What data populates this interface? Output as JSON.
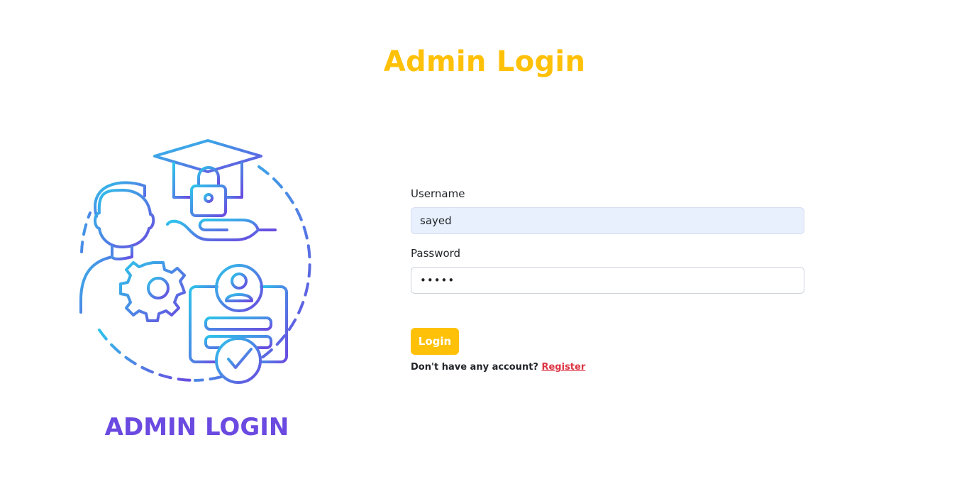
{
  "page": {
    "title": "Admin Login"
  },
  "illustration": {
    "caption": "ADMIN LOGIN",
    "icons": [
      "graduation-cap-icon",
      "padlock-icon",
      "hand-icon",
      "user-icon",
      "gear-icon",
      "id-card-icon",
      "checkmark-icon"
    ],
    "gradient_colors": [
      "#2ec4ea",
      "#6a4ae0"
    ]
  },
  "form": {
    "username_label": "Username",
    "username_value": "sayed",
    "password_label": "Password",
    "password_value": "•••••",
    "login_label": "Login",
    "register_prompt": "Don't have any account?",
    "register_link": "Register"
  },
  "colors": {
    "accent": "#ffc107",
    "caption": "#6a4ae0",
    "link": "#dc3545"
  }
}
